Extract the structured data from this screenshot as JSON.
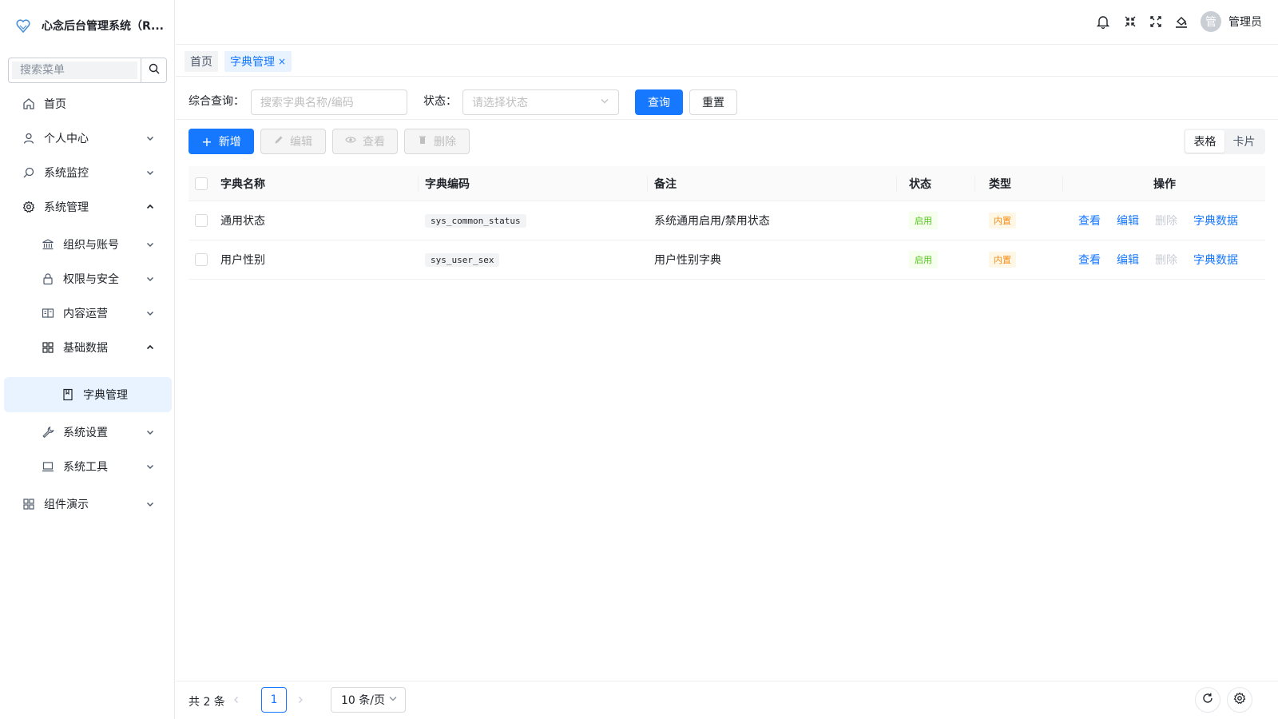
{
  "app": {
    "title": "心念后台管理系统（R..."
  },
  "sidebar": {
    "search_placeholder": "搜索菜单",
    "items": [
      {
        "label": "首页",
        "icon": "home-icon"
      },
      {
        "label": "个人中心",
        "icon": "user-icon"
      },
      {
        "label": "系统监控",
        "icon": "monitor-icon"
      },
      {
        "label": "系统管理",
        "icon": "gear-icon"
      },
      {
        "label": "组织与账号",
        "icon": "bank-icon"
      },
      {
        "label": "权限与安全",
        "icon": "lock-icon"
      },
      {
        "label": "内容运营",
        "icon": "book-icon"
      },
      {
        "label": "基础数据",
        "icon": "grid-icon"
      },
      {
        "label": "字典管理",
        "icon": "document-icon"
      },
      {
        "label": "系统设置",
        "icon": "wrench-icon"
      },
      {
        "label": "系统工具",
        "icon": "laptop-icon"
      },
      {
        "label": "组件演示",
        "icon": "grid-icon"
      }
    ]
  },
  "header": {
    "user_name": "管理员",
    "avatar_text": "管"
  },
  "tabs": [
    {
      "label": "首页"
    },
    {
      "label": "字典管理",
      "close": "×"
    }
  ],
  "filter": {
    "query_label": "综合查询：",
    "query_placeholder": "搜索字典名称/编码",
    "status_label": "状态：",
    "status_placeholder": "请选择状态",
    "search_button": "查询",
    "reset_button": "重置"
  },
  "toolbar": {
    "add": "新增",
    "edit": "编辑",
    "view": "查看",
    "delete": "删除",
    "view_table": "表格",
    "view_card": "卡片"
  },
  "table": {
    "columns": [
      "字典名称",
      "字典编码",
      "备注",
      "状态",
      "类型",
      "操作"
    ],
    "rows": [
      {
        "name": "通用状态",
        "code": "sys_common_status",
        "remark": "系统通用启用/禁用状态",
        "status": "启用",
        "type": "内置"
      },
      {
        "name": "用户性别",
        "code": "sys_user_sex",
        "remark": "用户性别字典",
        "status": "启用",
        "type": "内置"
      }
    ],
    "actions": {
      "view": "查看",
      "edit": "编辑",
      "delete": "删除",
      "data": "字典数据"
    }
  },
  "pagination": {
    "total": "共 2 条",
    "current": "1",
    "page_size": "10 条/页"
  },
  "colors": {
    "primary": "#1677ff",
    "active_bg": "#e8f3ff",
    "success": "#52c41a",
    "warning": "#fa8c16"
  }
}
